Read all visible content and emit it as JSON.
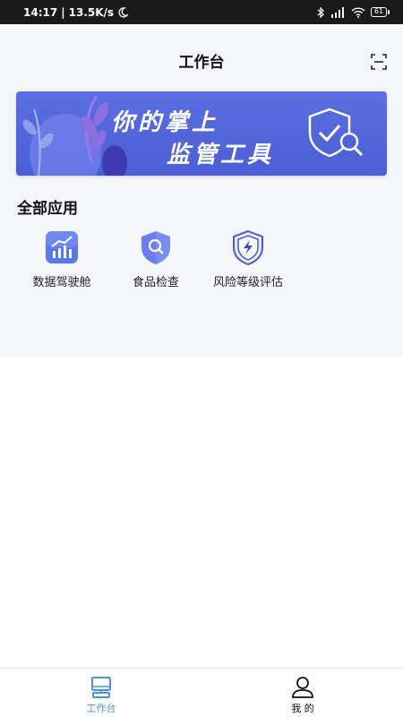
{
  "status_bar": {
    "time": "14:17",
    "separator": "|",
    "net_speed": "13.5K/s",
    "battery": "61"
  },
  "header": {
    "title": "工作台"
  },
  "banner": {
    "line1": "你的掌上",
    "line2": "监管工具",
    "background": "#4f63d9"
  },
  "section": {
    "title": "全部应用"
  },
  "apps": [
    {
      "label": "数据驾驶舱",
      "icon": "chart-icon"
    },
    {
      "label": "食品检查",
      "icon": "shield-search-icon"
    },
    {
      "label": "风险等级评估",
      "icon": "shield-bolt-icon"
    }
  ],
  "tabbar": {
    "tabs": [
      {
        "label": "工作台",
        "icon": "monitor-icon",
        "active": true
      },
      {
        "label": "我 的",
        "icon": "person-icon",
        "active": false
      }
    ],
    "active_color": "#4a90e2"
  }
}
